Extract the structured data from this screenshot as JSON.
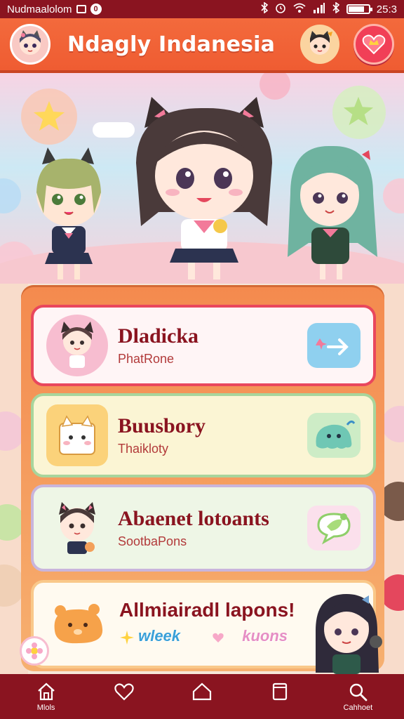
{
  "status_bar": {
    "left_text": "Nudmaalolom",
    "badge": "0",
    "time": "25:3",
    "battery_level_percent": 80
  },
  "app_bar": {
    "title": "Ndagly Indanesia"
  },
  "cards": [
    {
      "name": "Dladicka",
      "subtitle": "PhatRone",
      "action_icon": "arrow-right-icon"
    },
    {
      "name": "Buusbory",
      "subtitle": "Thaikloty",
      "action_icon": "blob-icon"
    },
    {
      "name": "Abaenet lotoants",
      "subtitle": "SootbaPons",
      "action_icon": "chat-bubble-icon"
    },
    {
      "name": "Allmiairadl lapons!",
      "tags": [
        "wleek",
        "kuons"
      ]
    }
  ],
  "bottom_nav": [
    {
      "icon": "home-icon",
      "label": "Mlols"
    },
    {
      "icon": "heart-icon",
      "label": ""
    },
    {
      "icon": "house-icon",
      "label": ""
    },
    {
      "icon": "window-icon",
      "label": ""
    },
    {
      "icon": "search-icon",
      "label": "Cahhoet"
    }
  ],
  "colors": {
    "status_bar": "#8a1420",
    "app_bar": "#f36a3c",
    "accent_red": "#e9475d",
    "card_title": "#8a1420"
  }
}
